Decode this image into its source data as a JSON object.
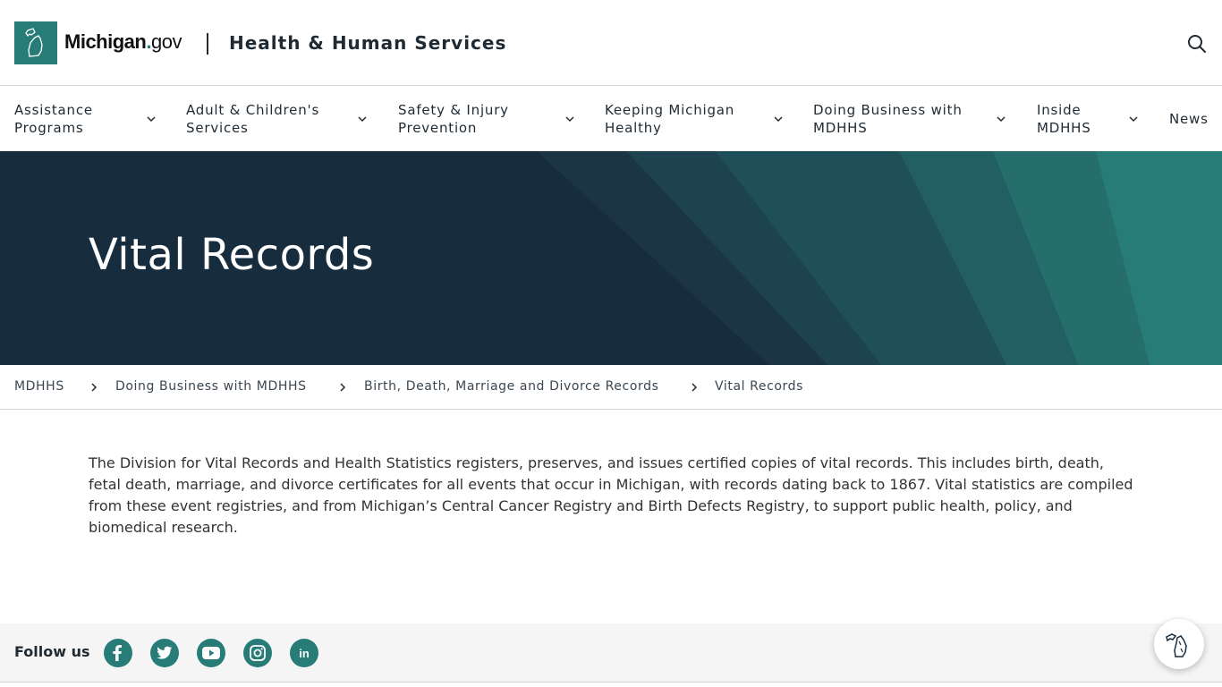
{
  "header": {
    "logo_mich": "Michigan",
    "logo_dot": ".",
    "logo_gov": "gov",
    "site_title": "Health & Human Services",
    "search_icon": "search-icon"
  },
  "nav": {
    "items": [
      {
        "line1": "Assistance",
        "line2": "Programs"
      },
      {
        "line1": "Adult & Children's",
        "line2": "Services"
      },
      {
        "line1": "Safety & Injury",
        "line2": "Prevention"
      },
      {
        "line1": "Keeping Michigan",
        "line2": "Healthy"
      },
      {
        "line1": "Doing Business with",
        "line2": "MDHHS"
      },
      {
        "line1": "Inside",
        "line2": "MDHHS"
      }
    ],
    "news": "News"
  },
  "hero": {
    "title": "Vital Records",
    "colors": {
      "base": "#172c3d",
      "band1": "#1b3545",
      "band2": "#1d4250",
      "band3": "#1f505a",
      "band4": "#225f63",
      "band5": "#256e6c",
      "band6": "#277c78"
    }
  },
  "breadcrumb": {
    "items": [
      "MDHHS",
      "Doing Business with MDHHS",
      "Birth, Death, Marriage and Divorce Records",
      "Vital Records"
    ]
  },
  "content": {
    "paragraph": "The Division for Vital Records and Health Statistics registers, preserves, and issues certified copies of vital records. This includes birth, death, fetal death, marriage, and divorce certificates for all events that occur in Michigan, with records dating back to 1867. Vital statistics are compiled from these event registries, and from Michigan’s Central Cancer Registry and Birth Defects Registry, to support public health, policy, and biomedical research."
  },
  "footer": {
    "follow_label": "Follow us",
    "social": [
      "facebook-icon",
      "twitter-icon",
      "youtube-icon",
      "instagram-icon",
      "linkedin-icon"
    ],
    "linkedin_text": "in",
    "accent": "#277c78"
  }
}
